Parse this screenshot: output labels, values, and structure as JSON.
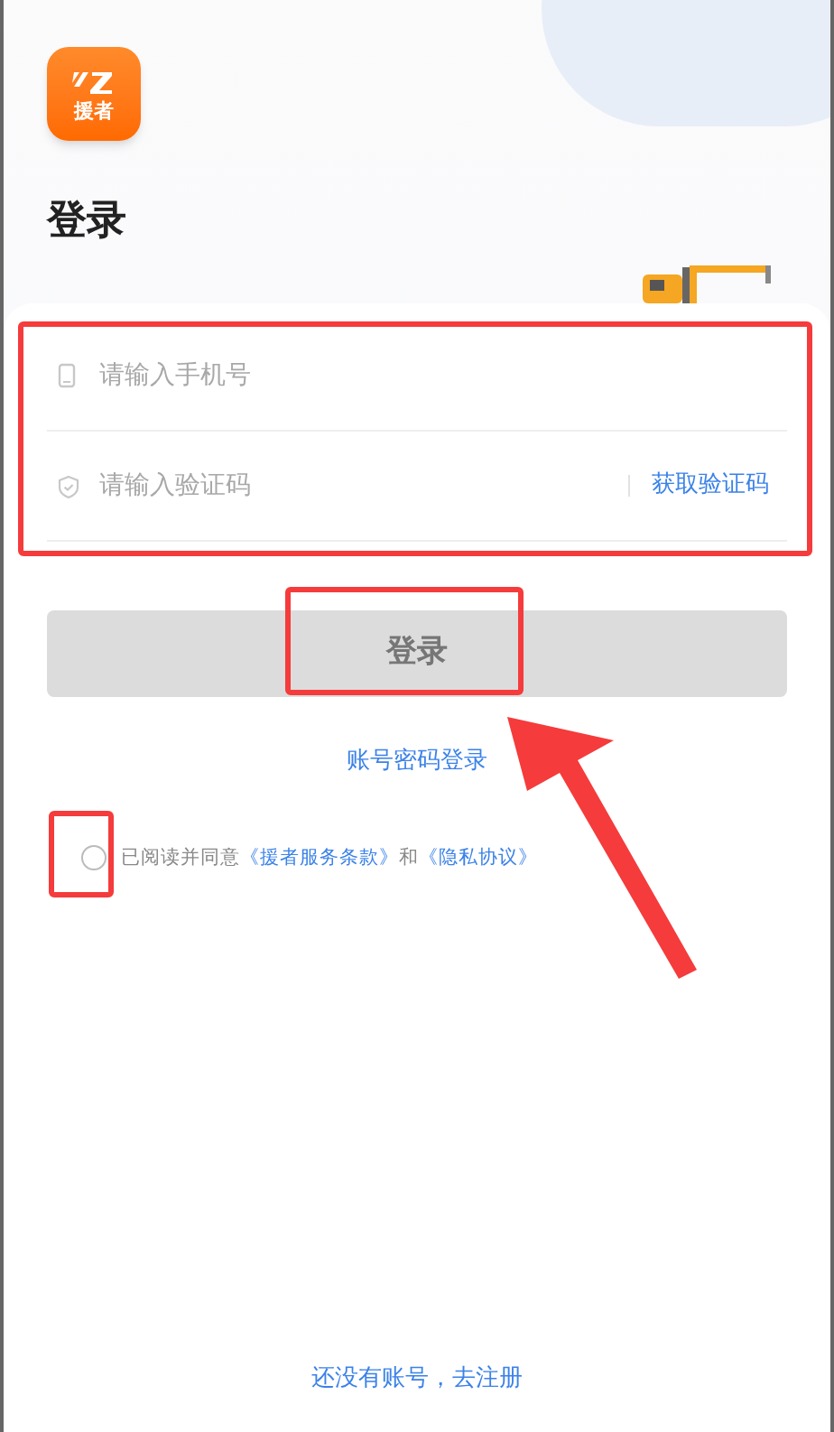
{
  "app_logo": {
    "text": "援者"
  },
  "title": "登录",
  "fields": [
    {
      "kind": "phone",
      "placeholder": "请输入手机号"
    },
    {
      "kind": "code",
      "placeholder": "请输入验证码",
      "action": "获取验证码"
    }
  ],
  "login_button": {
    "label": "登录",
    "disabled": true
  },
  "alt_login": "账号密码登录",
  "agreement": {
    "checked": false,
    "prefix": "已阅读并同意",
    "terms_link": "《援者服务条款》",
    "conjunction": "和",
    "privacy_link": "《隐私协议》"
  },
  "register_link": "还没有账号，去注册"
}
